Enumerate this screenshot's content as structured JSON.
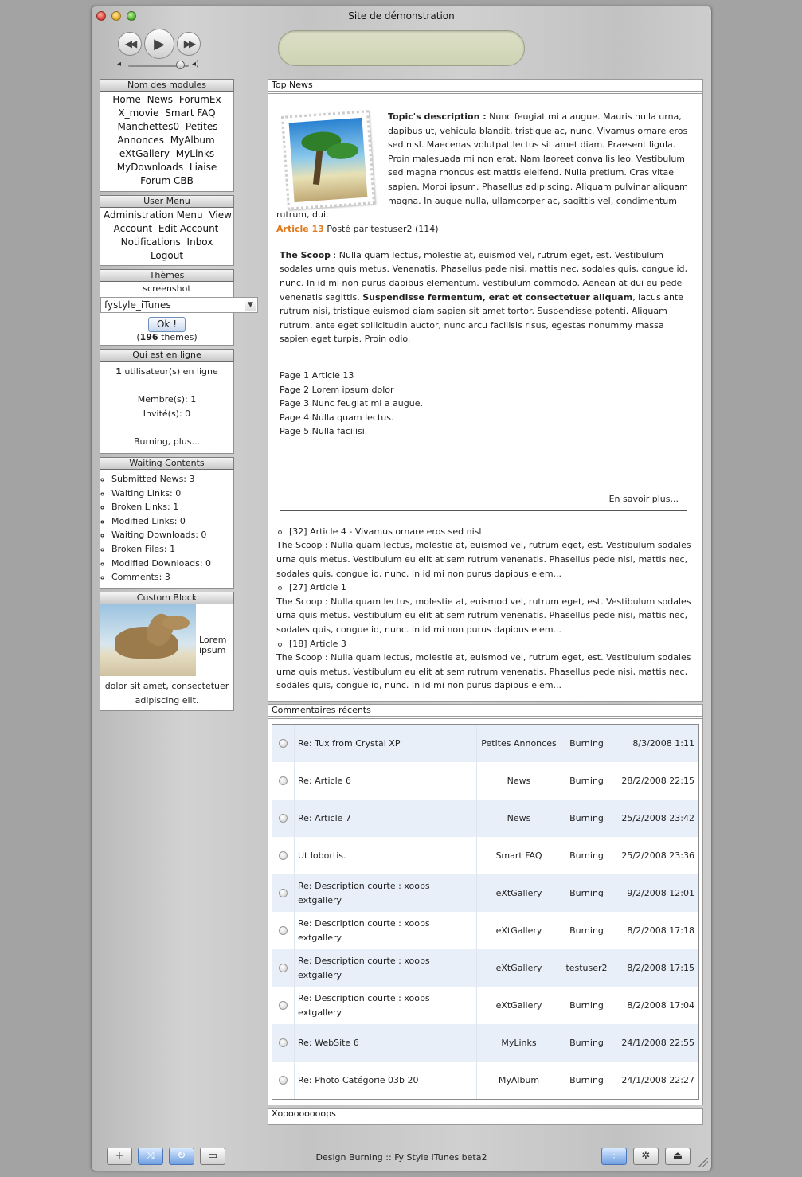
{
  "window": {
    "title": "Site de démonstration"
  },
  "player": {
    "rewind_icon": "rewind-icon",
    "play_icon": "play-icon",
    "forward_icon": "fast-forward-icon"
  },
  "modules_block": {
    "title": "Nom des modules",
    "items": [
      "Home",
      "News",
      "ForumEx",
      "X_movie",
      "Smart FAQ",
      "Manchettes0",
      "Petites Annonces",
      "MyAlbum",
      "eXtGallery",
      "MyLinks",
      "MyDownloads",
      "Liaise",
      "Forum CBB"
    ]
  },
  "user_menu": {
    "title": "User Menu",
    "items": [
      "Administration Menu",
      "View Account",
      "Edit Account",
      "Notifications",
      "Inbox",
      "Logout"
    ]
  },
  "themes": {
    "title": "Thèmes",
    "screenshot_label": "screenshot",
    "selected": "fystyle_iTunes",
    "ok_label": "Ok !",
    "count": "196",
    "count_suffix": " themes)",
    "count_prefix": "("
  },
  "online": {
    "title": "Qui est en ligne",
    "users_count": "1",
    "users_label": " utilisateur(s) en ligne",
    "members": "Membre(s): 1",
    "guests": "Invité(s): 0",
    "who": "Burning, plus..."
  },
  "waiting": {
    "title": "Waiting Contents",
    "items": [
      "Submitted News: 3",
      "Waiting Links: 0",
      "Broken Links: 1",
      "Modified Links: 0",
      "Waiting Downloads: 0",
      "Broken Files: 1",
      "Modified Downloads: 0",
      "Comments: 3"
    ]
  },
  "custom_block": {
    "title": "Custom Block",
    "text_right": "Lorem ipsum",
    "text_bottom": "dolor sit amet, consectetuer adipiscing elit."
  },
  "top_news": {
    "title": "Top News",
    "topic_label": "Topic's description :",
    "topic_text": " Nunc feugiat mi a augue. Mauris nulla urna, dapibus ut, vehicula blandit, tristique ac, nunc. Vivamus ornare eros sed nisl. Maecenas volutpat lectus sit amet diam. Praesent ligula. Proin malesuada mi non erat. Nam laoreet convallis leo. Vestibulum sed magna rhoncus est mattis eleifend. Nulla pretium. Cras vitae sapien. Morbi ipsum. Phasellus adipiscing. Aliquam pulvinar aliquam magna. In augue nulla, ullamcorper ac, sagittis vel, condimentum rutrum, dui.",
    "article_link": "Article 13",
    "article_meta": " Posté par testuser2 (114)",
    "scoop_label": "The Scoop",
    "scoop_text_1": " : Nulla quam lectus, molestie at, euismod vel, rutrum eget, est. Vestibulum sodales urna quis metus. Venenatis. Phasellus pede nisi, mattis nec, sodales quis, congue id, nunc. In id mi non purus dapibus elementum. Vestibulum commodo. Aenean at dui eu pede venenatis sagittis. ",
    "scoop_bold": "Suspendisse fermentum, erat et consectetuer aliquam",
    "scoop_text_2": ", lacus ante rutrum nisi, tristique euismod diam sapien sit amet tortor. Suspendisse potenti. Aliquam rutrum, ante eget sollicitudin auctor, nunc arcu facilisis risus, egestas nonummy massa sapien eget turpis. Proin odio.",
    "pages": [
      "Page 1 Article 13",
      "Page 2 Lorem ipsum dolor",
      "Page 3 Nunc feugiat mi a augue.",
      "Page 4 Nulla quam lectus.",
      "Page 5 Nulla facilisi."
    ],
    "read_more": "En savoir plus...",
    "more": [
      {
        "title": "[32] Article 4 - Vivamus ornare eros sed nisl",
        "text": "The Scoop : Nulla quam lectus, molestie at, euismod vel, rutrum eget, est. Vestibulum sodales urna quis metus. Vestibulum eu elit at sem rutrum venenatis. Phasellus pede nisi, mattis nec, sodales quis, congue id, nunc. In id mi non purus dapibus elem..."
      },
      {
        "title": "[27] Article 1",
        "text": "The Scoop : Nulla quam lectus, molestie at, euismod vel, rutrum eget, est. Vestibulum sodales urna quis metus. Vestibulum eu elit at sem rutrum venenatis. Phasellus pede nisi, mattis nec, sodales quis, congue id, nunc. In id mi non purus dapibus elem..."
      },
      {
        "title": "[18] Article 3",
        "text": "The Scoop : Nulla quam lectus, molestie at, euismod vel, rutrum eget, est. Vestibulum sodales urna quis metus. Vestibulum eu elit at sem rutrum venenatis. Phasellus pede nisi, mattis nec, sodales quis, congue id, nunc. In id mi non purus dapibus elem..."
      }
    ]
  },
  "comments": {
    "title": "Commentaires récents",
    "rows": [
      {
        "title": "Re: Tux from Crystal XP",
        "module": "Petites Annonces",
        "poster": "Burning",
        "date": "8/3/2008 1:11"
      },
      {
        "title": "Re: Article 6",
        "module": "News",
        "poster": "Burning",
        "date": "28/2/2008 22:15"
      },
      {
        "title": "Re: Article 7",
        "module": "News",
        "poster": "Burning",
        "date": "25/2/2008 23:42"
      },
      {
        "title": "Ut lobortis.",
        "module": "Smart FAQ",
        "poster": "Burning",
        "date": "25/2/2008 23:36"
      },
      {
        "title": "Re: Description courte : xoops extgallery",
        "module": "eXtGallery",
        "poster": "Burning",
        "date": "9/2/2008 12:01"
      },
      {
        "title": "Re: Description courte : xoops extgallery",
        "module": "eXtGallery",
        "poster": "Burning",
        "date": "8/2/2008 17:18"
      },
      {
        "title": "Re: Description courte : xoops extgallery",
        "module": "eXtGallery",
        "poster": "testuser2",
        "date": "8/2/2008 17:15"
      },
      {
        "title": "Re: Description courte : xoops extgallery",
        "module": "eXtGallery",
        "poster": "Burning",
        "date": "8/2/2008 17:04"
      },
      {
        "title": "Re: WebSite 6",
        "module": "MyLinks",
        "poster": "Burning",
        "date": "24/1/2008 22:55"
      },
      {
        "title": "Re: Photo Catégorie 03b 20",
        "module": "MyAlbum",
        "poster": "Burning",
        "date": "24/1/2008 22:27"
      }
    ]
  },
  "xo_block": {
    "title": "Xooooooooops"
  },
  "footer": {
    "credit": "Design Burning :: Fy Style iTunes beta2",
    "left_buttons": [
      "add-icon",
      "shuffle-icon",
      "repeat-icon",
      "artwork-icon"
    ],
    "right_buttons": [
      "equalizer-icon",
      "visualizer-icon",
      "eject-icon"
    ]
  }
}
